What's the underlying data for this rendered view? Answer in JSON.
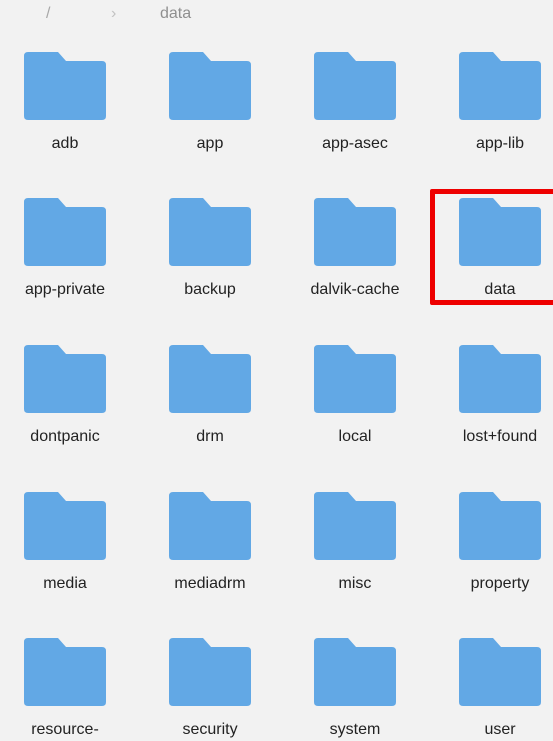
{
  "breadcrumb": {
    "root": "/",
    "separator": "›",
    "current": "data"
  },
  "folder_color": "#62a8e5",
  "highlight_color": "#ee0000",
  "highlighted_folder": "data",
  "folders": [
    {
      "label": "adb"
    },
    {
      "label": "app"
    },
    {
      "label": "app-asec"
    },
    {
      "label": "app-lib"
    },
    {
      "label": "app-private"
    },
    {
      "label": "backup"
    },
    {
      "label": "dalvik-cache"
    },
    {
      "label": "data"
    },
    {
      "label": "dontpanic"
    },
    {
      "label": "drm"
    },
    {
      "label": "local"
    },
    {
      "label": "lost+found"
    },
    {
      "label": "media"
    },
    {
      "label": "mediadrm"
    },
    {
      "label": "misc"
    },
    {
      "label": "property"
    },
    {
      "label": "resource-"
    },
    {
      "label": "security"
    },
    {
      "label": "system"
    },
    {
      "label": "user"
    }
  ]
}
